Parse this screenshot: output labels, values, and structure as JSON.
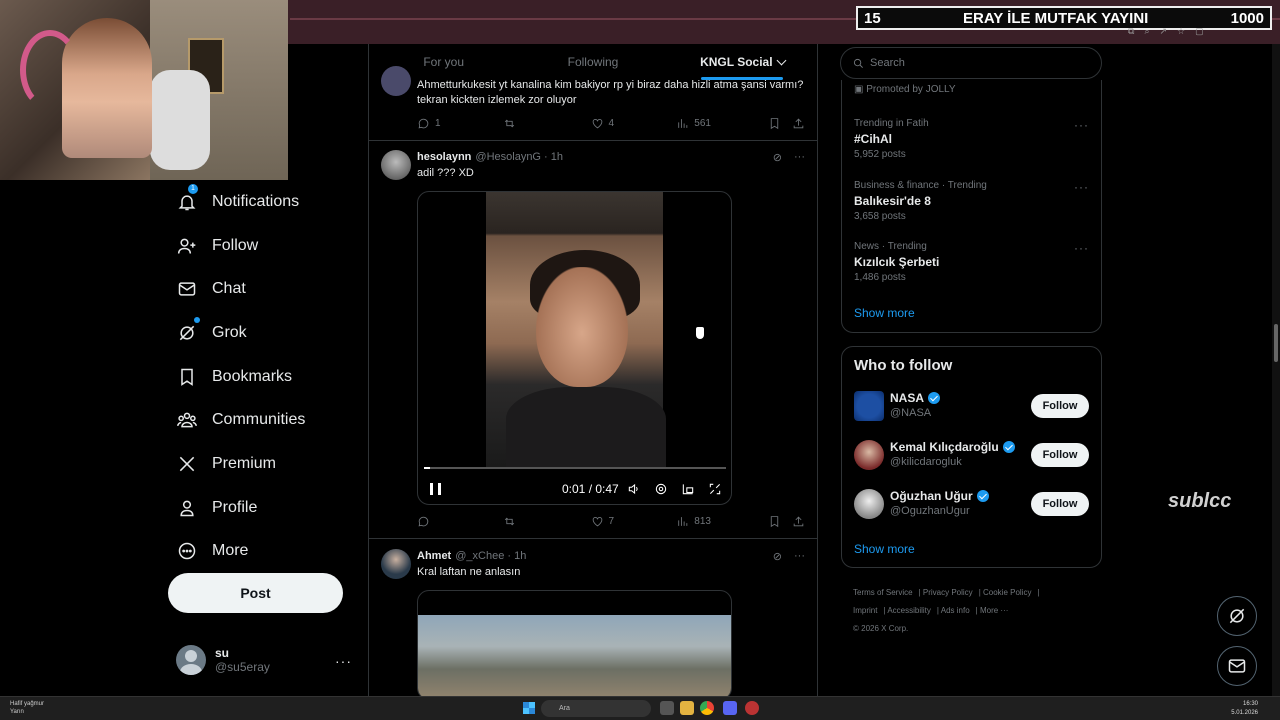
{
  "overlay": {
    "left": "15",
    "title": "ERAY İLE MUTFAK YAYINI",
    "right": "1000"
  },
  "nav": {
    "items": [
      {
        "label": "Notifications",
        "badge": "1"
      },
      {
        "label": "Follow"
      },
      {
        "label": "Chat"
      },
      {
        "label": "Grok"
      },
      {
        "label": "Bookmarks"
      },
      {
        "label": "Communities"
      },
      {
        "label": "Premium"
      },
      {
        "label": "Profile"
      },
      {
        "label": "More"
      }
    ],
    "post_label": "Post",
    "account": {
      "name": "su",
      "handle": "@su5eray"
    }
  },
  "tabs": [
    {
      "label": "For you"
    },
    {
      "label": "Following"
    },
    {
      "label": "KNGL Social"
    }
  ],
  "tweets": [
    {
      "text": "Ahmetturkukesit yt kanalina kim bakiyor rp yi biraz daha hizli atma şansi varmı?tekran kickten izlemek zor oluyor",
      "replies": "1",
      "reposts": "",
      "likes": "4",
      "views": "561"
    },
    {
      "name": "hesolaynn",
      "handle": "@HesolaynG · 1h",
      "text": "adil ??? XD",
      "video_time": "0:01 / 0:47",
      "video_progress": 0.02,
      "replies": "",
      "reposts": "",
      "likes": "7",
      "views": "813"
    },
    {
      "name": "Ahmet",
      "handle": "@_xChee · 1h",
      "text": "Kral laftan ne anlasın"
    }
  ],
  "right": {
    "search_placeholder": "Search",
    "promoted": "Promoted by JOLLY",
    "trends": [
      {
        "category": "Trending in Fatih",
        "name": "#CihAl",
        "posts": "5,952 posts"
      },
      {
        "category": "Business & finance · Trending",
        "name": "Balıkesir'de 8",
        "posts": "3,658 posts"
      },
      {
        "category": "News · Trending",
        "name": "Kızılcık Şerbeti",
        "posts": "1,486 posts"
      }
    ],
    "show_more": "Show more",
    "who_to_follow": "Who to follow",
    "users": [
      {
        "name": "NASA",
        "handle": "@NASA",
        "follow": "Follow"
      },
      {
        "name": "Kemal Kılıçdaroğlu",
        "handle": "@kilicdarogluk",
        "follow": "Follow"
      },
      {
        "name": "Oğuzhan Uğur",
        "handle": "@OguzhanUgur",
        "follow": "Follow"
      }
    ],
    "show_more_2": "Show more",
    "footer": [
      "Terms of Service",
      "Privacy Policy",
      "Cookie Policy",
      "Imprint",
      "Accessibility",
      "Ads info",
      "More ···",
      "© 2026 X Corp."
    ]
  },
  "watermark": "sublcc",
  "taskbar": {
    "weather_title": "Hafif yağmur",
    "weather_sub": "Yarın",
    "search": "Ara",
    "time": "16:30",
    "date": "5.01.2026"
  },
  "colors": {
    "accent": "#1d9bf0",
    "background": "#000000",
    "text": "#e7e9ea",
    "muted": "#71767b",
    "border": "#2f3336"
  }
}
